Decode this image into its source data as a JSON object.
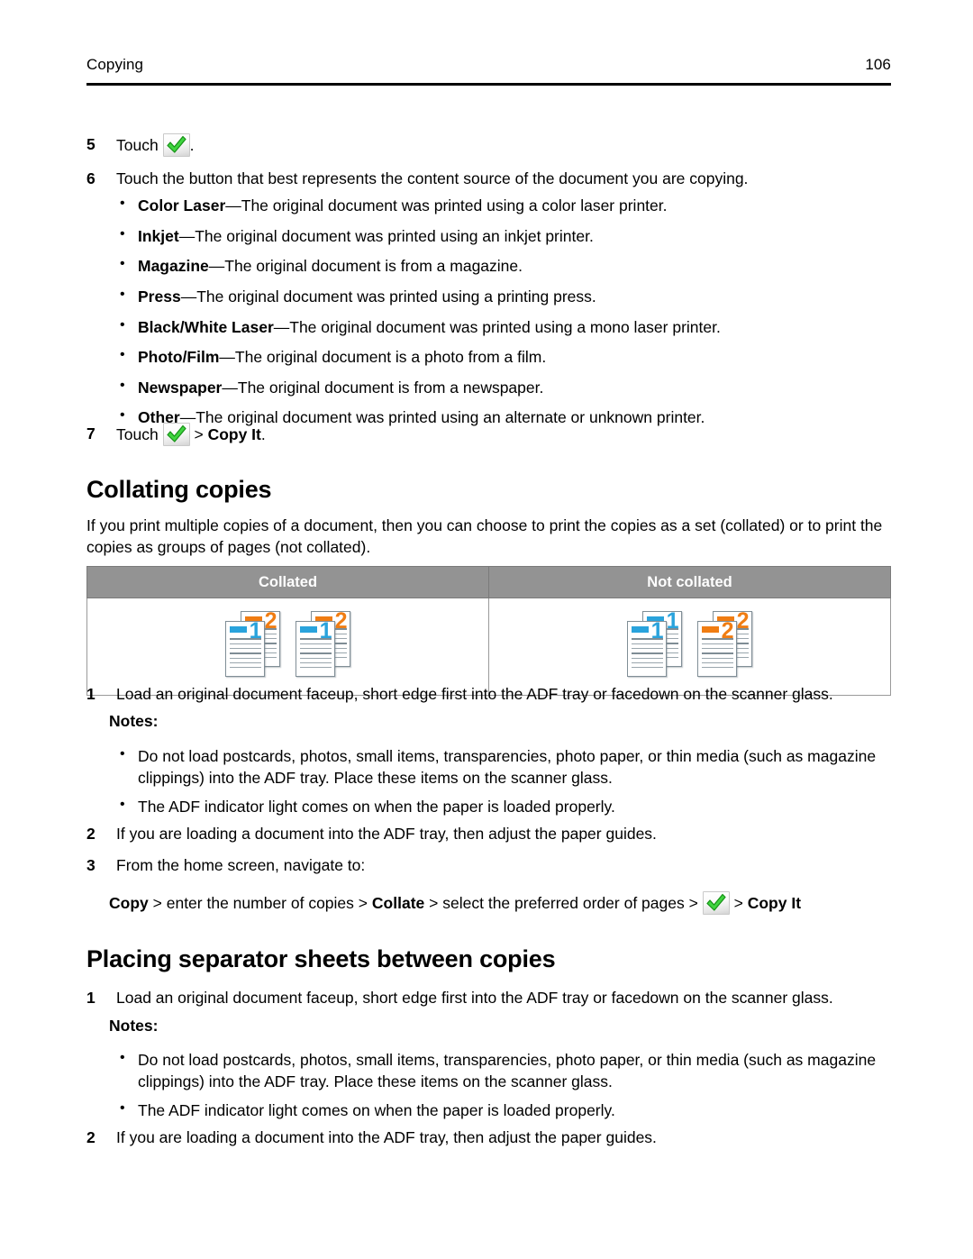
{
  "header": {
    "title": "Copying",
    "page_number": "106"
  },
  "icons": {
    "check": "green-check-icon"
  },
  "colors": {
    "table_header_bg": "#939393",
    "table_header_text": "#ffffff",
    "check_green": "#3fd43f",
    "check_green_dark": "#1a9e1a",
    "doc_blue": "#29a3dc",
    "doc_orange": "#f07d13",
    "doc_line": "#9aa6ad",
    "doc_border": "#808e96"
  },
  "steps_top": {
    "step5": {
      "number": "5",
      "text_before": "Touch",
      "text_after": "."
    },
    "step6": {
      "number": "6",
      "text": "Touch the button that best represents the content source of the document you are copying.",
      "options": [
        {
          "term": "Color Laser",
          "desc": "—The original document was printed using a color laser printer."
        },
        {
          "term": "Inkjet",
          "desc": "—The original document was printed using an inkjet printer."
        },
        {
          "term": "Magazine",
          "desc": "—The original document is from a magazine."
        },
        {
          "term": "Press",
          "desc": "—The original document was printed using a printing press."
        },
        {
          "term": "Black/White Laser",
          "desc": "—The original document was printed using a mono laser printer."
        },
        {
          "term": "Photo/Film",
          "desc": "—The original document is a photo from a film."
        },
        {
          "term": "Newspaper",
          "desc": "—The original document is from a newspaper."
        },
        {
          "term": "Other",
          "desc": "—The original document was printed using an alternate or unknown printer."
        }
      ]
    },
    "step7": {
      "number": "7",
      "text_before": "Touch",
      "separator": ">",
      "bold_target": "Copy It",
      "text_after": "."
    }
  },
  "collating": {
    "heading": "Collating copies",
    "intro": "If you print multiple copies of a document, then you can choose to print the copies as a set (collated) or to print the copies as groups of pages (not collated).",
    "table": {
      "columns": [
        "Collated",
        "Not collated"
      ],
      "collated_pattern": [
        "1",
        "2",
        "1",
        "2"
      ],
      "not_collated_pattern": [
        "1",
        "1",
        "2",
        "2"
      ]
    },
    "steps": [
      {
        "number": "1",
        "text": "Load an original document faceup, short edge first into the ADF tray or facedown on the scanner glass.",
        "notes_label": "Notes:",
        "notes": [
          "Do not load postcards, photos, small items, transparencies, photo paper, or thin media (such as magazine clippings) into the ADF tray. Place these items on the scanner glass.",
          "The ADF indicator light comes on when the paper is loaded properly."
        ]
      },
      {
        "number": "2",
        "text": "If you are loading a document into the ADF tray, then adjust the paper guides."
      },
      {
        "number": "3",
        "text": "From the home screen, navigate to:"
      }
    ],
    "navigation": {
      "item1": "Copy",
      "sep1": ">",
      "item2": "enter the number of copies",
      "sep2": ">",
      "item3": "Collate",
      "sep3": ">",
      "item4": "select the preferred order of pages",
      "sep4": ">",
      "sep5": ">",
      "item5": "Copy It"
    }
  },
  "separator_sheets": {
    "heading": "Placing separator sheets between copies",
    "steps": [
      {
        "number": "1",
        "text": "Load an original document faceup, short edge first into the ADF tray or facedown on the scanner glass.",
        "notes_label": "Notes:",
        "notes": [
          "Do not load postcards, photos, small items, transparencies, photo paper, or thin media (such as magazine clippings) into the ADF tray. Place these items on the scanner glass.",
          "The ADF indicator light comes on when the paper is loaded properly."
        ]
      },
      {
        "number": "2",
        "text": "If you are loading a document into the ADF tray, then adjust the paper guides."
      }
    ]
  }
}
